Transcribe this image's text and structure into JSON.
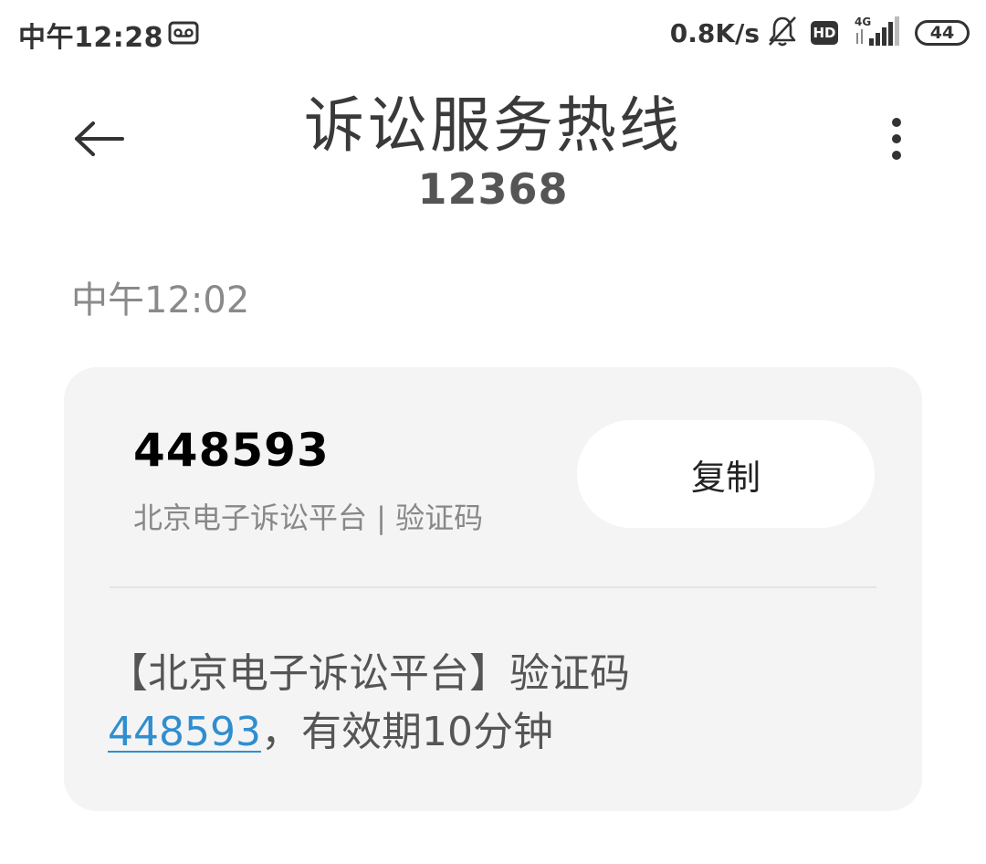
{
  "status_bar": {
    "time": "中午12:28",
    "net_speed": "0.8K/s",
    "hd_label": "HD",
    "network_type": "4G",
    "battery": "44",
    "icons": [
      "cassette-icon",
      "bell-muted-icon",
      "hd-icon",
      "signal-icon",
      "battery-icon"
    ]
  },
  "header": {
    "title": "诉讼服务热线",
    "number": "12368",
    "back_icon": "arrow-left-icon",
    "more_icon": "more-vertical-icon"
  },
  "message": {
    "time": "中午12:02",
    "code": "448593",
    "code_desc": "北京电子诉讼平台 | 验证码",
    "copy_label": "复制",
    "body_prefix": "【北京电子诉讼平台】验证码",
    "body_code": "448593",
    "body_suffix": "，有效期10分钟"
  },
  "colors": {
    "card_bg": "#f4f4f4",
    "link": "#2f8ecf",
    "muted_text": "#888888"
  }
}
